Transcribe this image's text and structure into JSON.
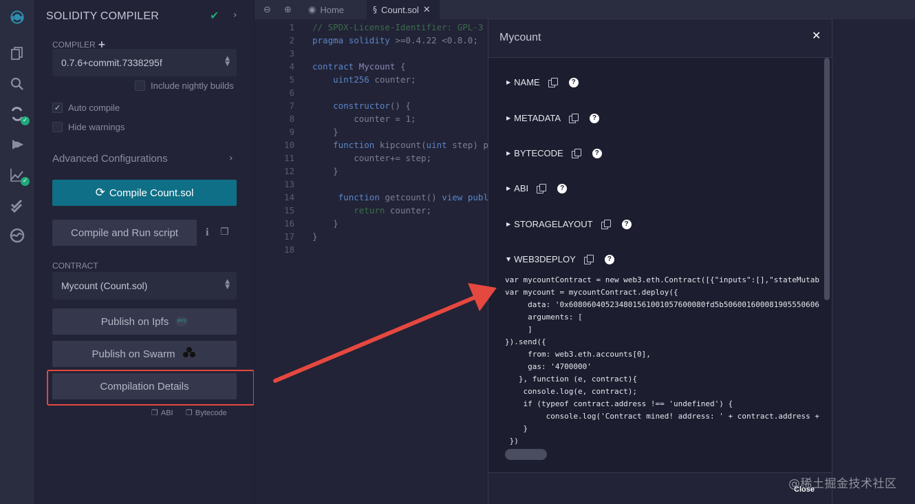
{
  "iconbar": {
    "icons": [
      "remix-logo-icon",
      "file-explorer-icon",
      "search-icon",
      "solidity-compiler-icon",
      "deploy-run-icon",
      "analysis-icon",
      "verify-icon",
      "debugger-icon"
    ]
  },
  "panel": {
    "title": "SOLIDITY COMPILER",
    "compiler_label": "COMPILER",
    "compiler_version": "0.7.6+commit.7338295f",
    "include_nightly": "Include nightly builds",
    "auto_compile": "Auto compile",
    "hide_warnings": "Hide warnings",
    "advanced": "Advanced Configurations",
    "compile_button": "Compile Count.sol",
    "compile_run_button": "Compile and Run script",
    "contract_label": "CONTRACT",
    "contract_value": "Mycount (Count.sol)",
    "publish_ipfs": "Publish on Ipfs",
    "ipfs_badge": "IPFS",
    "publish_swarm": "Publish on Swarm",
    "compilation_details": "Compilation Details",
    "abi_link": "ABI",
    "bytecode_link": "Bytecode"
  },
  "tabs": {
    "home": "Home",
    "file": "Count.sol"
  },
  "code": {
    "lines": [
      {
        "n": "1",
        "html": "<span class='cm'>// SPDX-License-Identifier: GPL-3</span>"
      },
      {
        "n": "2",
        "html": "<span class='kw'>pragma</span> <span class='kw'>solidity</span> <span class='pl'>&gt;=0.4.22 &lt;0.8.0;</span>"
      },
      {
        "n": "3",
        "html": ""
      },
      {
        "n": "4",
        "html": "<span class='kw'>contract</span> <span class='fn'>Mycount</span> <span class='pl'>{</span>"
      },
      {
        "n": "5",
        "html": "    <span class='kw'>uint256</span> <span class='pl'>counter;</span>"
      },
      {
        "n": "6",
        "html": ""
      },
      {
        "n": "7",
        "html": "    <span class='kw'>constructor</span><span class='pl'>() {</span>"
      },
      {
        "n": "8",
        "html": "        <span class='pl'>counter = 1;</span>"
      },
      {
        "n": "9",
        "html": "    <span class='pl'>}</span>"
      },
      {
        "n": "10",
        "html": "    <span class='kw'>function</span> <span class='pl'>kipcount(</span><span class='kw'>uint</span> <span class='pl'>step) p</span>"
      },
      {
        "n": "11",
        "html": "        <span class='pl'>counter+= step;</span>"
      },
      {
        "n": "12",
        "html": "    <span class='pl'>}</span>"
      },
      {
        "n": "13",
        "html": ""
      },
      {
        "n": "14",
        "html": "     <span class='kw'>function</span> <span class='pl'>getcount()</span> <span class='kw'>view</span> <span class='kw'>publ</span>"
      },
      {
        "n": "15",
        "html": "        <span class='cm'>return</span> <span class='pl'>counter;</span>"
      },
      {
        "n": "16",
        "html": "    <span class='pl'>}</span>"
      },
      {
        "n": "17",
        "html": "<span class='pl'>}</span>"
      },
      {
        "n": "18",
        "html": ""
      }
    ]
  },
  "modal": {
    "title": "Mycount",
    "sections": [
      "NAME",
      "METADATA",
      "BYTECODE",
      "ABI",
      "STORAGELAYOUT",
      "WEB3DEPLOY"
    ],
    "deploy_code": "var mycountContract = new web3.eth.Contract([{\"inputs\":[],\"stateMutab\nvar mycount = mycountContract.deploy({\n     data: '0x608060405234801561001057600080fd5b506001600081905550606\n     arguments: [\n     ]\n}).send({\n     from: web3.eth.accounts[0],\n     gas: '4700000'\n   }, function (e, contract){\n    console.log(e, contract);\n    if (typeof contract.address !== 'undefined') {\n         console.log('Contract mined! address: ' + contract.address +\n    }\n })",
    "close": "Close"
  },
  "watermark": "@稀土掘金技术社区",
  "colors": {
    "accent": "#0f6f86",
    "success": "#1ea97a",
    "highlight": "#e5483f"
  }
}
